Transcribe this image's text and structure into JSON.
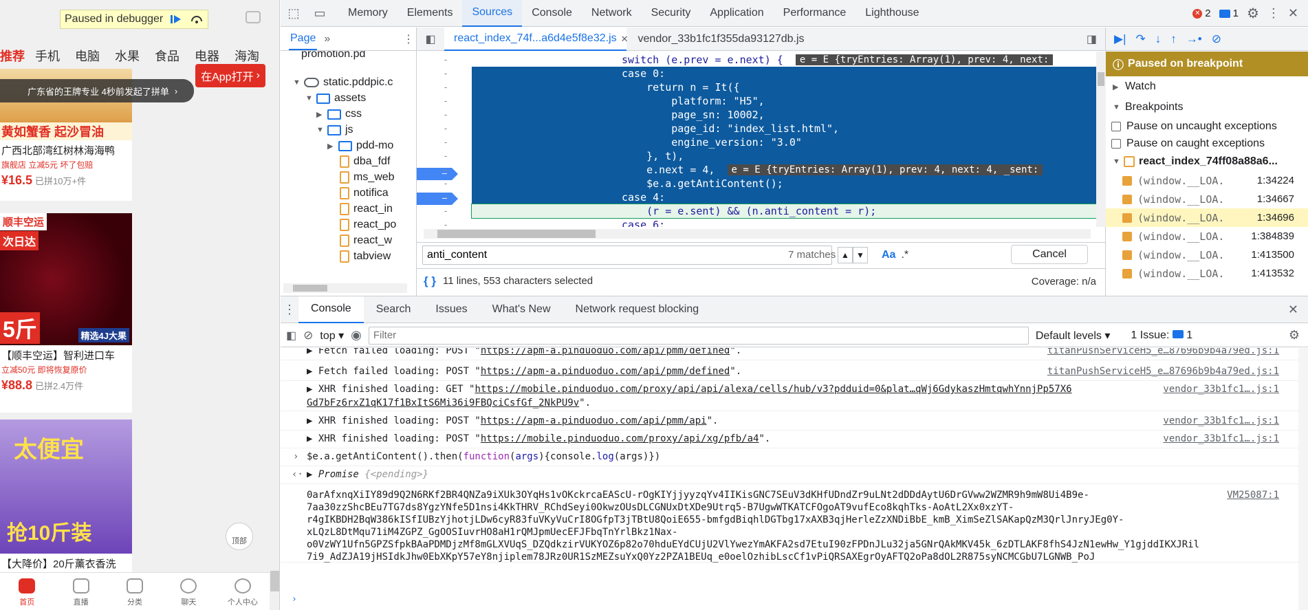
{
  "mobile": {
    "debug_banner": "Paused in debugger",
    "categories": [
      "推荐",
      "手机",
      "电脑",
      "水果",
      "食品",
      "电器",
      "海淘"
    ],
    "notice": "广东省的王牌专业 4秒前发起了拼单",
    "open_app": "在App打开",
    "cards": [
      {
        "title": "广西北部湾红树林海海鸭",
        "tags": "旗舰店  立减5元  坏了包赔",
        "price": "¥16.5",
        "sold": "已拼10万+件"
      },
      {
        "title": "【顺丰空运】智利进口车",
        "tags": "立减50元  即将恢复原价",
        "price": "¥88.8",
        "sold": "已拼2.4万件"
      },
      {
        "title": "【大降价】20斤薰衣香洗",
        "tags": "",
        "price": "",
        "sold": ""
      }
    ],
    "card1_banner": "黄如蟹香 起沙冒油",
    "card2_tag1": "顺丰空运",
    "card2_tag2": "次日达",
    "card2_big": "5斤",
    "card2_promo": "精选4J大果",
    "card3_l1": "太便宜",
    "card3_l2": "抢10斤装",
    "backtop": "顶部",
    "bottom_nav": [
      "首页",
      "直播",
      "分类",
      "聊天",
      "个人中心"
    ]
  },
  "devtools": {
    "main_tabs": [
      "Memory",
      "Elements",
      "Sources",
      "Console",
      "Network",
      "Security",
      "Application",
      "Performance",
      "Lighthouse"
    ],
    "errors": "2",
    "messages": "1",
    "nav_tab": "Page",
    "tree": [
      "promotion.pd",
      "static.pddpic.c",
      "assets",
      "css",
      "js",
      "pdd-mo",
      "dba_fdf",
      "ms_web",
      "notifica",
      "react_in",
      "react_po",
      "react_w",
      "tabview"
    ],
    "file_tabs": [
      "react_index_74f...a6d4e5f8e32.js",
      "vendor_33b1fc1f355da93127db.js"
    ],
    "code": [
      {
        "g": "-",
        "t": "switch (e.prev = e.next) {  ",
        "v": "e = E {tryEntries: Array(1), prev: 4, next:"
      },
      {
        "g": "-",
        "t": "case 0:"
      },
      {
        "g": "-",
        "t": "    return n = It({"
      },
      {
        "g": "-",
        "t": "        platform: \"H5\","
      },
      {
        "g": "-",
        "t": "        page_sn: 10002,"
      },
      {
        "g": "-",
        "t": "        page_id: \"index_list.html\","
      },
      {
        "g": "-",
        "t": "        engine_version: \"3.0\""
      },
      {
        "g": "-",
        "t": "    }, t),"
      },
      {
        "g": "-",
        "t": "    e.next = 4,  ",
        "v": "e = E {tryEntries: Array(1), prev: 4, next: 4, _sent:"
      },
      {
        "g": "-",
        "t": "    $e.a.getAntiContent();"
      },
      {
        "g": "-",
        "t": "case 4:"
      },
      {
        "g": "-",
        "t": "    (r = e.sent) && (n.anti_content = r);"
      },
      {
        "g": "-",
        "t": "case 6:"
      }
    ],
    "search_value": "anti_content",
    "matches": "7 matches",
    "match_case": "Aa",
    "regex": ".*",
    "cancel": "Cancel",
    "status": "11 lines, 553 characters selected",
    "coverage": "Coverage: n/a",
    "paused": "Paused on breakpoint",
    "watch": "Watch",
    "breakpoints": "Breakpoints",
    "pause_uncaught": "Pause on uncaught exceptions",
    "pause_caught": "Pause on caught exceptions",
    "bp_file": "react_index_74ff08a88a6...",
    "bp_rows": [
      {
        "code": "(window.__LOA...",
        "loc": "1:34224"
      },
      {
        "code": "(window.__LOA...",
        "loc": "1:34667"
      },
      {
        "code": "(window.__LOA...",
        "loc": "1:34696"
      },
      {
        "code": "(window.__LOA...",
        "loc": "1:384839"
      },
      {
        "code": "(window.__LOA...",
        "loc": "1:413500"
      },
      {
        "code": "(window.__LOA...",
        "loc": "1:413532"
      }
    ],
    "drawer_tabs": [
      "Console",
      "Search",
      "Issues",
      "What's New",
      "Network request blocking"
    ],
    "context": "top",
    "filter_placeholder": "Filter",
    "levels": "Default levels",
    "issues": "1 Issue:",
    "issues_count": "1",
    "console": {
      "m1": {
        "a": "Fetch failed loading: POST \"",
        "u": "https://apm-a.pinduoduo.com/api/pmm/defined",
        "b": "\".",
        "src": "titanPushServiceH5_e…87696b9b4a79ed.js:1"
      },
      "m2": {
        "a": "Fetch failed loading: POST \"",
        "u": "https://apm-a.pinduoduo.com/api/pmm/defined",
        "b": "\".",
        "src": "titanPushServiceH5_e…87696b9b4a79ed.js:1"
      },
      "m3": {
        "a": "XHR finished loading: GET \"",
        "u": "https://mobile.pinduoduo.com/proxy/api/api/alexa/cells/hub/v3?pdduid=0&plat…qWj6GdykaszHmtqwhYnnjPp57X6",
        "u2": "Gd7bFz6rxZ1qK17f1BxItS6Mi36i9FBQciCsfGf_2NkPU9v",
        "b": "\".",
        "src": "vendor_33b1fc1….js:1"
      },
      "m4": {
        "a": "XHR finished loading: POST \"",
        "u": "https://apm-a.pinduoduo.com/api/pmm/api",
        "b": "\".",
        "src": "vendor_33b1fc1….js:1"
      },
      "m5": {
        "a": "XHR finished loading: POST \"",
        "u": "https://mobile.pinduoduo.com/proxy/api/xg/pfb/a4",
        "b": "\".",
        "src": "vendor_33b1fc1….js:1"
      },
      "input": {
        "p1": "$e.a.getAntiContent().then(",
        "k": "function",
        "p2": "(",
        "arg": "args",
        "p3": "){console.",
        "fn": "log",
        "p4": "(args)})"
      },
      "promise": {
        "a": "Promise ",
        "b": "{<pending>}"
      },
      "result_src": "VM25087:1",
      "result": [
        "0arAfxnqXiIY89d9Q2N6RKf2BR4QNZa9iXUk3OYqHs1vOKckrcaEAScU-rOgKIYjjyyzqYv4IIKisGNC7SEuV3dKHfUDndZr9uLNt2dDDdAytU6DrGVww2WZMR9h9mW8Ui4B9e-",
        "7aa30zzShcBEu7TG7ds8YgzYNfe5D1nsi4KkTHRV_RChdSeyi0OkwzOUsDLCGNUxDtXDe9Utrq5-B7UgwWTKATCFOgoAT9vufEco8kqhTks-AoAtL2Xx0xzYT-",
        "r4gIKBDH2BqW386kISfIUBzYjhotjLDw6cyR83fuVKyVuCrI8OGfpT3jTBtU8QoiE655-bmfgdBiqhlDGTbg17xAXB3qjHerleZzXNDiBbE_kmB_XimSeZlSAKapQzM3QrlJnryJEg0Y-",
        "xLQzL8DtMqu71iM4ZGPZ_GgOOSIuvrHO8aH1rQMJpmUecEFJFbqTnYrlBkz1Nax-",
        "o0VzWY1Ufn5GPZSfpkBAaPDMDjzMf8mGLXVUqS_DZQdkzirVUKYOZ6p82o70hduEYdCUjU2VlYwezYmAKFA2sd7EtuI90zFPDnJLu32ja5GNrQAkMKV45k_6zDTLAKF8fhS4JzN1ewHw_Y1gjddIKXJRil",
        "7i9_AdZJA19jHSIdkJhw0EbXKpY57eY8njiplem78JRz0UR1SzMEZsuYxQ0Yz2PZA1BEUq_e0oelOzhibLscCf1vPiQRSAXEgrOyAFTQ2oPa8dOL2R875syNCMCGbU7LGNWB_PoJ"
      ]
    }
  },
  "colors": {
    "accent": "#1a73e8",
    "pdd_red": "#e02e24",
    "paused": "#b18f24",
    "selection": "#0d5a9e"
  }
}
